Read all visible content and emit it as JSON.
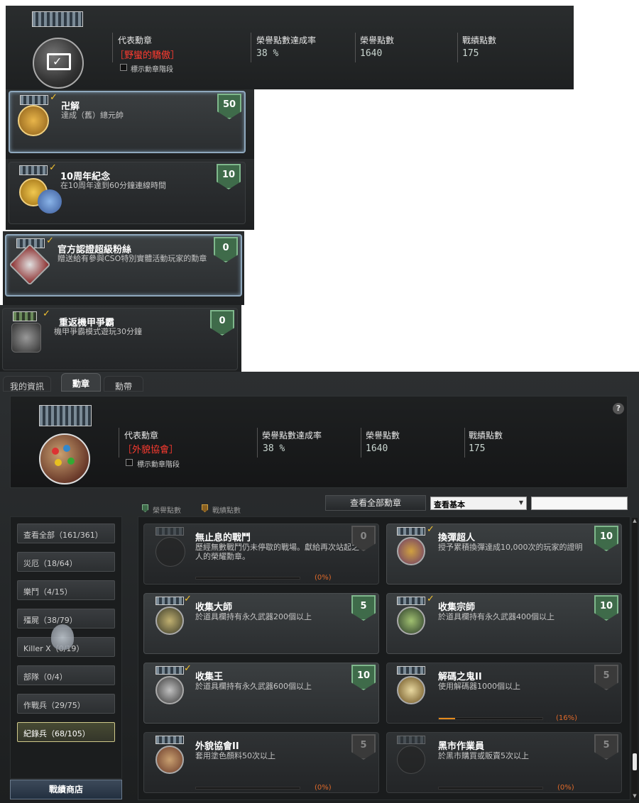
{
  "top_header": {
    "labels": {
      "representative": "代表勳章",
      "honor_rate": "榮譽點數達成率",
      "honor_points": "榮譽點數",
      "record_points": "戰績點數"
    },
    "representative_name": "［野蠻的驕傲］",
    "honor_rate": "38 %",
    "honor_points": "1640",
    "record_points": "175",
    "show_stage": "標示勳章階段"
  },
  "top_cards": [
    {
      "title": "卍解",
      "desc": "達成（舊）總元帥",
      "points": "50",
      "shield": "green"
    },
    {
      "title": "10周年紀念",
      "desc": "在10周年達到60分鐘連線時間",
      "points": "10",
      "shield": "green"
    },
    {
      "title": "官方認證超級粉絲",
      "desc": "贈送給有參與CSO特別實體活動玩家的勳章",
      "points": "0",
      "shield": "green"
    },
    {
      "title": "重返機甲爭霸",
      "desc": "機甲爭霸模式遊玩30分鐘",
      "points": "0",
      "shield": "green"
    }
  ],
  "tabs": [
    {
      "label": "我的資訊"
    },
    {
      "label": "勳章"
    },
    {
      "label": "勳帶"
    }
  ],
  "main_header": {
    "labels": {
      "representative": "代表勳章",
      "honor_rate": "榮譽點數達成率",
      "honor_points": "榮譽點數",
      "record_points": "戰績點數"
    },
    "representative_name": "［外貌協會］",
    "honor_rate": "38 %",
    "honor_points": "1640",
    "record_points": "175",
    "show_stage": "標示勳章階段",
    "help": "?"
  },
  "legend": {
    "honor": "榮譽點數",
    "record": "戰績點數"
  },
  "toolbar": {
    "view_all": "查看全部勳章",
    "select_value": "查看基本",
    "search_value": ""
  },
  "categories": [
    {
      "label": "查看全部（161/361）"
    },
    {
      "label": "災厄（18/64）"
    },
    {
      "label": "樂鬥（4/15）"
    },
    {
      "label": "殭屍（38/79）"
    },
    {
      "label": "Killer X（0/19）"
    },
    {
      "label": "部隊（0/4）"
    },
    {
      "label": "作戰兵（29/75）"
    },
    {
      "label": "紀錄兵（68/105）"
    }
  ],
  "shop_button": "戰績商店",
  "grid": [
    {
      "title": "無止息的戰鬥",
      "desc": "歷經無數戰鬥仍未停歇的戰場。獻給再次站起之人的榮耀勳章。",
      "points": "0",
      "earned": false,
      "progress": 0,
      "pct": "(0%)"
    },
    {
      "title": "換彈超人",
      "desc": "授予累積換彈達成10,000次的玩家的證明",
      "points": "10",
      "earned": true
    },
    {
      "title": "收集大師",
      "desc": "於道具欄持有永久武器200個以上",
      "points": "5",
      "earned": true
    },
    {
      "title": "收集宗師",
      "desc": "於道具欄持有永久武器400個以上",
      "points": "10",
      "earned": true
    },
    {
      "title": "收集王",
      "desc": "於道具欄持有永久武器600個以上",
      "points": "10",
      "earned": true
    },
    {
      "title": "解碼之鬼II",
      "desc": "使用解碼器1000個以上",
      "points": "5",
      "earned": false,
      "progress": 0.16,
      "pct": "(16%)"
    },
    {
      "title": "外貌協會II",
      "desc": "套用塗色顏料50次以上",
      "points": "5",
      "earned": false,
      "progress": 0,
      "pct": "(0%)"
    },
    {
      "title": "黑市作業員",
      "desc": "於黑市購買或販賣5次以上",
      "points": "5",
      "earned": false,
      "progress": 0,
      "pct": "(0%)"
    }
  ],
  "colors": {
    "accent_red": "#ff3b30",
    "green_shield": "#3f6b4a",
    "progress": "#e58a1c",
    "check": "#f2c232"
  }
}
